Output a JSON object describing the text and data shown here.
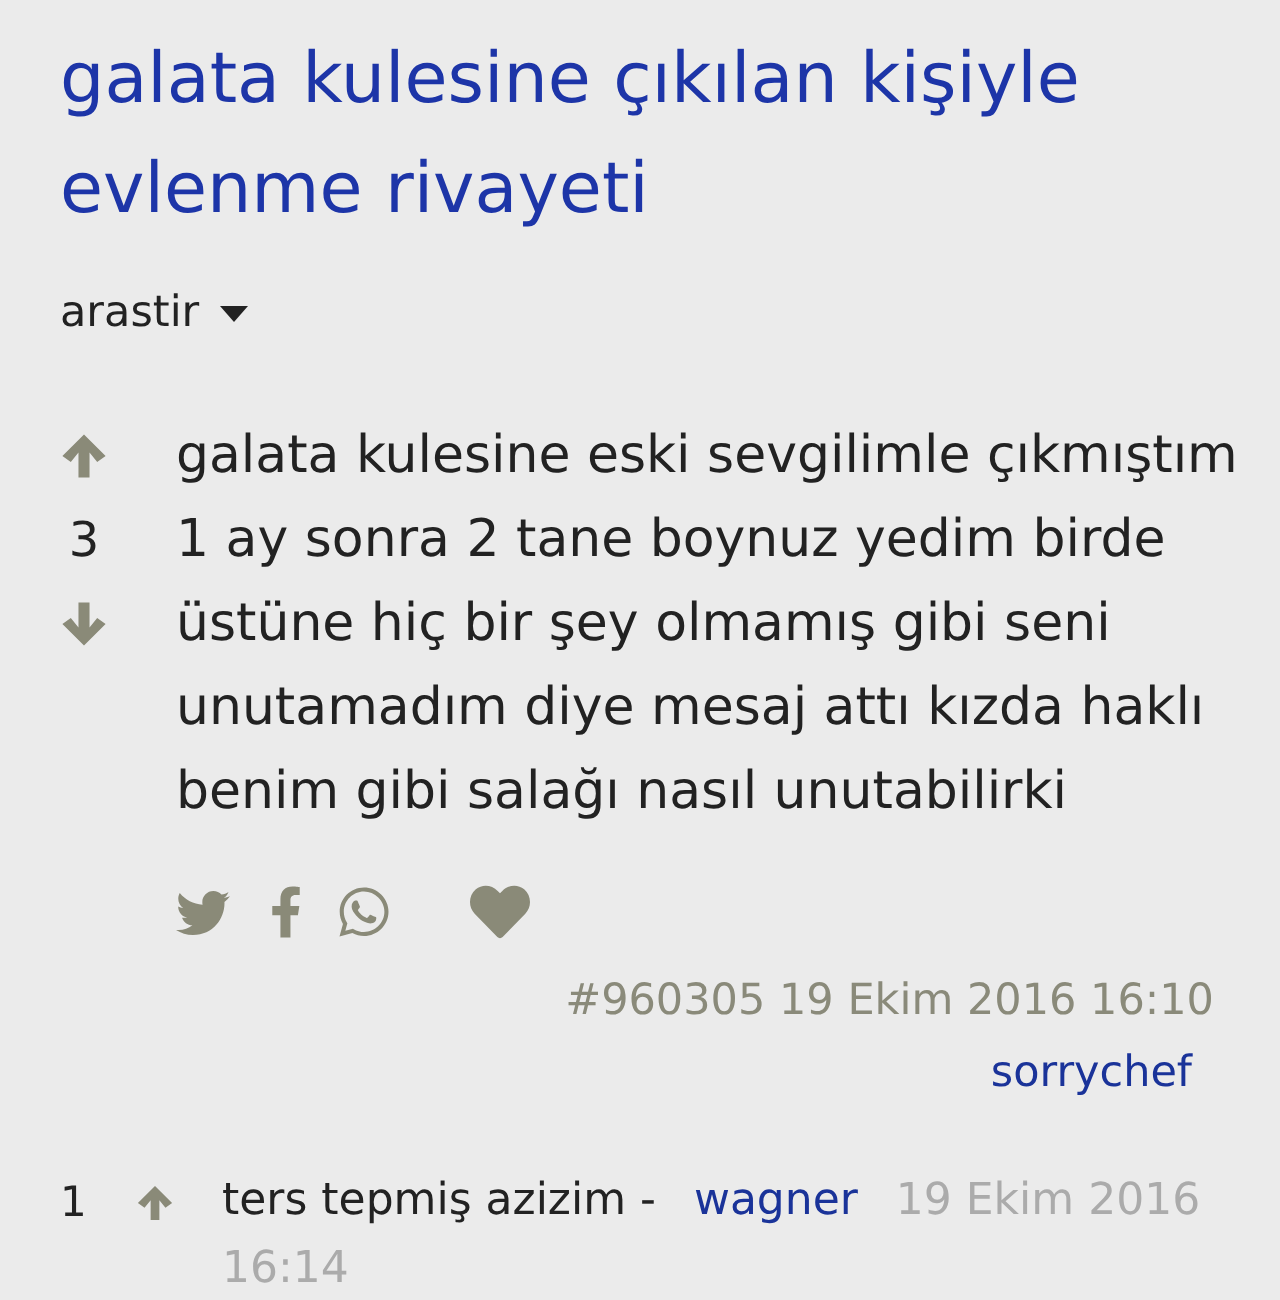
{
  "title": "galata kulesine çıkılan kişiyle evlenme rivayeti",
  "sort_menu": {
    "label": "arastir"
  },
  "entry": {
    "votes": "3",
    "text": "galata kulesine eski sevgilimle çıkmıştım 1 ay sonra 2 tane boynuz yedim birde üstüne hiç bir şey olmamış gibi seni unutamadım diye mesaj attı kızda haklı benim gibi salağı nasıl unutabilirki",
    "id": "#960305",
    "date": "19 Ekim 2016 16:10",
    "author": "sorrychef"
  },
  "comments": [
    {
      "votes": "1",
      "text": "ters tepmiş azizim -",
      "author": "wagner",
      "date": "19 Ekim 2016",
      "time": "16:14"
    }
  ]
}
